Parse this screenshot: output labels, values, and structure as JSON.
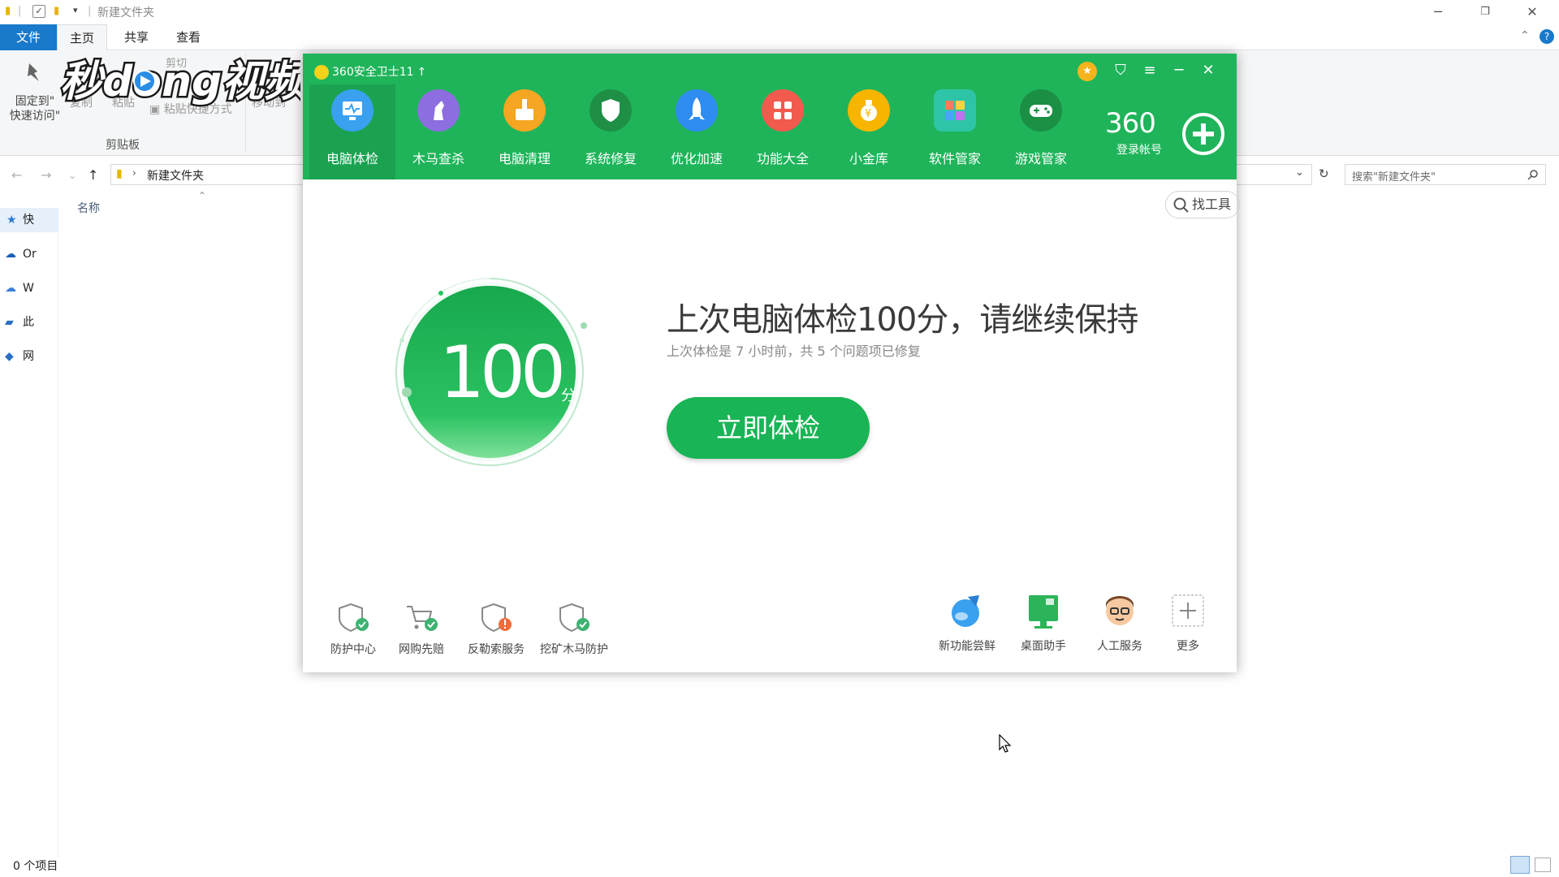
{
  "explorer": {
    "title": "新建文件夹",
    "tabs": {
      "file": "文件",
      "home": "主页",
      "share": "共享",
      "view": "查看"
    },
    "ribbon": {
      "pin_label_1": "固定到\"",
      "pin_label_2": "快速访问\"",
      "copy": "复制",
      "paste": "粘贴",
      "cut": "剪切",
      "paste_shortcut": "粘贴快捷方式",
      "move_to": "移动到",
      "clipboard_group": "剪贴板"
    },
    "address": {
      "path": "新建文件夹",
      "search_placeholder": "搜索\"新建文件夹\""
    },
    "nav": [
      {
        "label": "快",
        "icon": "star-icon"
      },
      {
        "label": "Or",
        "icon": "onedrive-icon"
      },
      {
        "label": "W",
        "icon": "cloud-icon"
      },
      {
        "label": "此",
        "icon": "computer-icon"
      },
      {
        "label": "网",
        "icon": "network-icon"
      }
    ],
    "column_name": "名称",
    "status": "0 个项目"
  },
  "watermark": {
    "text": "秒dong视频"
  },
  "app360": {
    "title": "360安全卫士11",
    "tabs": [
      {
        "label": "电脑体检",
        "icon": "monitor-icon",
        "color": "#3aa0f0"
      },
      {
        "label": "木马查杀",
        "icon": "horse-icon",
        "color": "#8c6ee0"
      },
      {
        "label": "电脑清理",
        "icon": "broom-icon",
        "color": "#f5a623"
      },
      {
        "label": "系统修复",
        "icon": "shield-icon",
        "color": "#1e8f45"
      },
      {
        "label": "优化加速",
        "icon": "rocket-icon",
        "color": "#2f8cf0"
      },
      {
        "label": "功能大全",
        "icon": "grid-icon",
        "color": "#f25a4e"
      },
      {
        "label": "小金库",
        "icon": "moneybag-icon",
        "color": "#f7b500"
      },
      {
        "label": "软件管家",
        "icon": "apps-icon",
        "color": "#2ec4a8"
      },
      {
        "label": "游戏管家",
        "icon": "gamepad-icon",
        "color": "#1b8f44"
      }
    ],
    "login": {
      "brand": "360",
      "label": "登录帐号"
    },
    "find_tool": "找工具",
    "score": {
      "value": "100",
      "unit": "分"
    },
    "headline": "上次电脑体检100分，请继续保持",
    "subline": "上次体检是 7 小时前，共 5 个问题项已修复",
    "scan_button": "立即体检",
    "bottom_left": [
      {
        "label": "防护中心",
        "icon": "protect-icon"
      },
      {
        "label": "网购先赔",
        "icon": "cart-icon"
      },
      {
        "label": "反勒索服务",
        "icon": "ransom-icon"
      },
      {
        "label": "挖矿木马防护",
        "icon": "mining-icon"
      }
    ],
    "bottom_right": [
      {
        "label": "新功能尝鲜",
        "icon": "new-feature-icon"
      },
      {
        "label": "桌面助手",
        "icon": "desktop-icon"
      },
      {
        "label": "人工服务",
        "icon": "support-icon"
      },
      {
        "label": "更多",
        "icon": "plus-icon"
      }
    ]
  }
}
